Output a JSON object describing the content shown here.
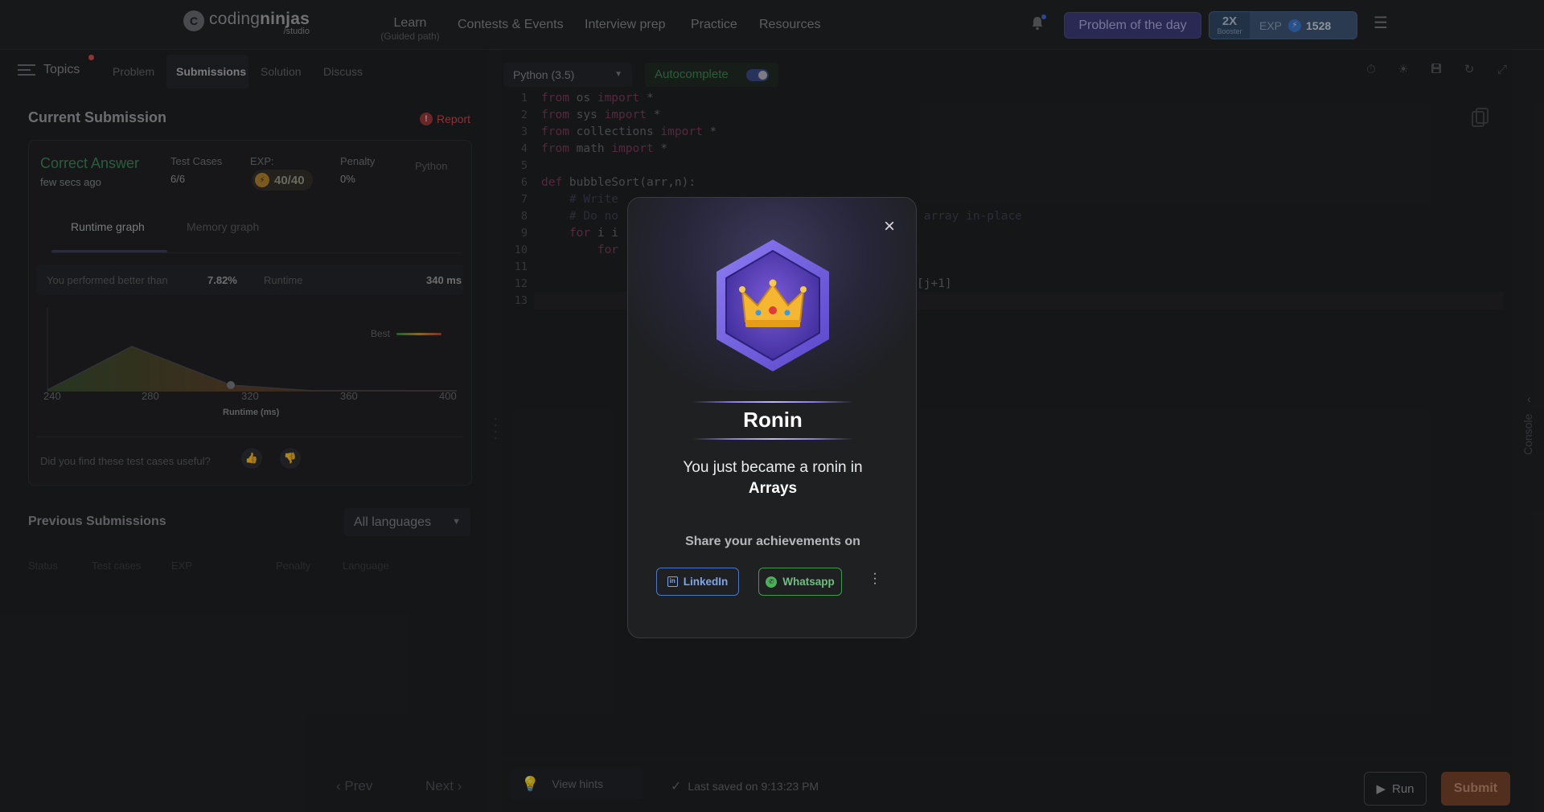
{
  "nav": {
    "logo_main_a": "coding",
    "logo_main_b": "ninjas",
    "logo_sub": "/studio",
    "learn": "Learn",
    "learn_sub": "(Guided path)",
    "contests": "Contests & Events",
    "interview": "Interview prep",
    "practice": "Practice",
    "resources": "Resources",
    "potd": "Problem of the day",
    "booster_x": "2X",
    "booster_label": "Booster",
    "exp_label": "EXP",
    "exp_value": "1528"
  },
  "left": {
    "topics": "Topics",
    "tabs": [
      "Problem",
      "Submissions",
      "Solution",
      "Discuss"
    ],
    "current_title": "Current Submission",
    "report": "Report",
    "result": "Correct Answer",
    "result_time": "few secs ago",
    "test_cases_label": "Test Cases",
    "test_cases_value": "6/6",
    "exp_label": "EXP:",
    "exp_value": "40/40",
    "penalty_label": "Penalty",
    "penalty_value": "0%",
    "language": "Python",
    "graph_tabs": [
      "Runtime graph",
      "Memory graph"
    ],
    "performed_label": "You performed better than",
    "performed_value": "7.82%",
    "runtime_label": "Runtime",
    "runtime_value": "340 ms",
    "best_label": "Best",
    "x_ticks": [
      "240",
      "280",
      "320",
      "360",
      "400"
    ],
    "x_axis_label": "Runtime (ms)",
    "useful_q": "Did you find these test cases useful?",
    "prev_title": "Previous Submissions",
    "lang_filter": "All languages",
    "prev_headers": [
      "Status",
      "Test cases",
      "EXP",
      "Penalty",
      "Language"
    ],
    "prev_btn": "Prev",
    "next_btn": "Next"
  },
  "editor": {
    "language": "Python (3.5)",
    "autocomplete": "Autocomplete",
    "line_numbers": [
      "1",
      "2",
      "3",
      "4",
      "5",
      "6",
      "7",
      "8",
      "9",
      "10",
      "11",
      "12",
      "13"
    ],
    "view_hints": "View hints",
    "last_saved": "Last saved on 9:13:23 PM",
    "run": "Run",
    "submit": "Submit",
    "console": "Console"
  },
  "code": {
    "l1_kw1": "from",
    "l1_mod": " os ",
    "l1_kw2": "import",
    "l1_rest": " *",
    "l2_kw1": "from",
    "l2_mod": " sys ",
    "l2_kw2": "import",
    "l2_rest": " *",
    "l3_kw1": "from",
    "l3_mod": " collections ",
    "l3_kw2": "import",
    "l3_rest": " *",
    "l4_kw1": "from",
    "l4_mod": " math ",
    "l4_kw2": "import",
    "l4_rest": " *",
    "l6_kw": "def",
    "l6_rest": " bubbleSort(arr,n):",
    "l7": "    # Write",
    "l8a": "    # Do no",
    "l8b": " array in-place",
    "l9_kw": "    for",
    "l9_rest": " i i",
    "l10": "        for",
    "l12": "[j+1]"
  },
  "modal": {
    "rank": "Ronin",
    "msg_line1": "You just became a ronin in",
    "msg_topic": "Arrays",
    "share": "Share your achievements on",
    "linkedin": "LinkedIn",
    "whatsapp": "Whatsapp"
  },
  "colors": {
    "accent_purple": "#3d3b7a",
    "success": "#3c8a57",
    "submit": "#7a4228",
    "linkedin": "#4a77c6",
    "whatsapp": "#3f9a4e"
  }
}
